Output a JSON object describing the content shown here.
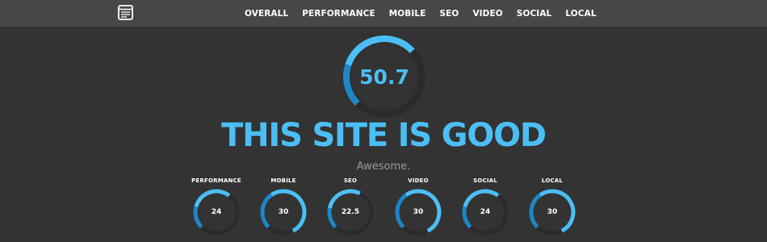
{
  "nav": {
    "logo_icon": "report-card-icon",
    "links": [
      "OVERALL",
      "PERFORMANCE",
      "MOBILE",
      "SEO",
      "VIDEO",
      "SOCIAL",
      "LOCAL"
    ]
  },
  "overall": {
    "score": "50.7",
    "score_fraction": 0.507
  },
  "headline": "THIS SITE IS GOOD",
  "subline": "Awesome.",
  "metrics": [
    {
      "label": "PERFORMANCE",
      "value": "24",
      "fraction": 0.48
    },
    {
      "label": "MOBILE",
      "value": "30",
      "fraction": 0.8
    },
    {
      "label": "SEO",
      "value": "22.5",
      "fraction": 0.45
    },
    {
      "label": "VIDEO",
      "value": "30",
      "fraction": 0.8
    },
    {
      "label": "SOCIAL",
      "value": "24",
      "fraction": 0.48
    },
    {
      "label": "LOCAL",
      "value": "30",
      "fraction": 0.8
    }
  ],
  "colors": {
    "background": "#333333",
    "navbar": "#474747",
    "accent": "#4bbff5",
    "gauge_dark": "#1d86c8",
    "gauge_track": "#2b2b2b"
  }
}
